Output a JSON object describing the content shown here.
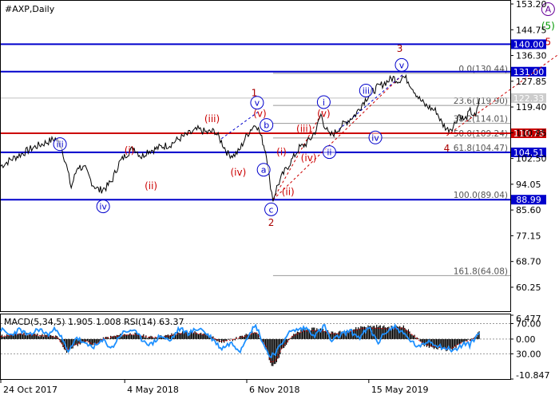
{
  "header": {
    "title": "#AXP,Daily"
  },
  "chart_data": [
    {
      "type": "line",
      "name": "price-panel",
      "ylim": [
        55.0,
        153.2
      ],
      "y_ticks": [
        153.2,
        144.75,
        136.3,
        127.85,
        119.4,
        110.95,
        102.5,
        94.05,
        85.6,
        77.15,
        68.7,
        60.25
      ],
      "x_labels": [
        "24 Oct 2017",
        "4 May 2018",
        "6 Nov 2018",
        "15 May 2019"
      ],
      "x_label_pos": [
        0,
        132,
        262,
        392
      ],
      "x_range": [
        0,
        540
      ],
      "price_path": [
        [
          0,
          100
        ],
        [
          10,
          102
        ],
        [
          22,
          104
        ],
        [
          34,
          106
        ],
        [
          46,
          107.5
        ],
        [
          58,
          109
        ],
        [
          64,
          107
        ],
        [
          70,
          100
        ],
        [
          75,
          93
        ],
        [
          82,
          100
        ],
        [
          90,
          99
        ],
        [
          98,
          94
        ],
        [
          105,
          92
        ],
        [
          112,
          93
        ],
        [
          118,
          95
        ],
        [
          126,
          101
        ],
        [
          134,
          104
        ],
        [
          142,
          106
        ],
        [
          150,
          103
        ],
        [
          156,
          105
        ],
        [
          164,
          105.5
        ],
        [
          172,
          106.5
        ],
        [
          180,
          107
        ],
        [
          190,
          109
        ],
        [
          200,
          110.5
        ],
        [
          210,
          112
        ],
        [
          220,
          111
        ],
        [
          228,
          111.5
        ],
        [
          235,
          108
        ],
        [
          242,
          104
        ],
        [
          248,
          103.5
        ],
        [
          254,
          105
        ],
        [
          260,
          109
        ],
        [
          266,
          112
        ],
        [
          272,
          114
        ],
        [
          277,
          110
        ],
        [
          280,
          107
        ],
        [
          283,
          104
        ],
        [
          286,
          96
        ],
        [
          290,
          89
        ],
        [
          294,
          93
        ],
        [
          300,
          97
        ],
        [
          306,
          100
        ],
        [
          312,
          103
        ],
        [
          318,
          106
        ],
        [
          324,
          107
        ],
        [
          330,
          109
        ],
        [
          336,
          112
        ],
        [
          341,
          117
        ],
        [
          344,
          114
        ],
        [
          350,
          110
        ],
        [
          356,
          111
        ],
        [
          362,
          113
        ],
        [
          370,
          115
        ],
        [
          378,
          117
        ],
        [
          386,
          121
        ],
        [
          394,
          124
        ],
        [
          402,
          126
        ],
        [
          410,
          127.5
        ],
        [
          418,
          129
        ],
        [
          424,
          128
        ],
        [
          428,
          129.5
        ],
        [
          434,
          128
        ],
        [
          440,
          125
        ],
        [
          446,
          122
        ],
        [
          452,
          120
        ],
        [
          458,
          119
        ],
        [
          464,
          118
        ],
        [
          470,
          114
        ],
        [
          476,
          112
        ],
        [
          482,
          113
        ],
        [
          488,
          117
        ],
        [
          494,
          115
        ],
        [
          500,
          118
        ],
        [
          506,
          116
        ],
        [
          510,
          122.3
        ]
      ],
      "levels": [
        {
          "value": 140.0,
          "label": "140.00",
          "color": "#0000cc"
        },
        {
          "value": 131.0,
          "label": "131.00",
          "color": "#0000cc"
        },
        {
          "value": 110.78,
          "label": "110.78",
          "color": "#cc0000"
        },
        {
          "value": 104.51,
          "label": "104.51",
          "color": "#0000cc"
        },
        {
          "value": 88.99,
          "label": "88.99",
          "color": "#0000cc"
        }
      ],
      "current_price": {
        "value": 122.33,
        "label": "122.33"
      },
      "fib_levels": [
        {
          "value": 130.44,
          "label": "0.0(130.44)"
        },
        {
          "value": 119.9,
          "label": "23.6(119.90)"
        },
        {
          "value": 114.01,
          "label": "38.2(114.01)"
        },
        {
          "value": 109.24,
          "label": "50.0(109.24)"
        },
        {
          "value": 104.47,
          "label": "61.8(104.47)"
        },
        {
          "value": 89.04,
          "label": "100.0(89.04)"
        },
        {
          "value": 64.08,
          "label": "161.8(64.08)"
        }
      ],
      "fib_x_start": 290,
      "wave_labels": [
        {
          "text": "A",
          "x": 583,
          "y": 151.5,
          "color": "#660099",
          "circle": true
        },
        {
          "text": "(5)",
          "x": 583,
          "y": 146.0,
          "color": "#009900",
          "circle": false
        },
        {
          "text": "5",
          "x": 583,
          "y": 140.8,
          "color": "#cc0000",
          "circle": false
        },
        {
          "text": "3",
          "x": 425,
          "y": 138.5,
          "color": "#aa0000",
          "circle": false
        },
        {
          "text": "v",
          "x": 427,
          "y": 133.2,
          "color": "#0000cc",
          "circle": true
        },
        {
          "text": "iii",
          "x": 389,
          "y": 124.8,
          "color": "#0000cc",
          "circle": true
        },
        {
          "text": "i",
          "x": 344,
          "y": 121.0,
          "color": "#0000cc",
          "circle": true
        },
        {
          "text": "(v)",
          "x": 344,
          "y": 117.2,
          "color": "#cc0000",
          "circle": false
        },
        {
          "text": "(iii)",
          "x": 323,
          "y": 112.2,
          "color": "#cc0000",
          "circle": false
        },
        {
          "text": "iv",
          "x": 399,
          "y": 109.4,
          "color": "#0000cc",
          "circle": true
        },
        {
          "text": "4",
          "x": 475,
          "y": 105.8,
          "color": "#aa0000",
          "circle": false
        },
        {
          "text": "(iv)",
          "x": 328,
          "y": 102.6,
          "color": "#cc0000",
          "circle": false
        },
        {
          "text": "ii",
          "x": 350,
          "y": 104.6,
          "color": "#0000cc",
          "circle": true
        },
        {
          "text": "(ii)",
          "x": 306,
          "y": 91.5,
          "color": "#cc0000",
          "circle": false
        },
        {
          "text": "(i)",
          "x": 299,
          "y": 104.6,
          "color": "#cc0000",
          "circle": false
        },
        {
          "text": "1",
          "x": 270,
          "y": 124.0,
          "color": "#aa0000",
          "circle": false
        },
        {
          "text": "v",
          "x": 273,
          "y": 120.8,
          "color": "#0000cc",
          "circle": true
        },
        {
          "text": "(v)",
          "x": 276,
          "y": 117.2,
          "color": "#cc0000",
          "circle": false
        },
        {
          "text": "b",
          "x": 283,
          "y": 113.5,
          "color": "#0000cc",
          "circle": true
        },
        {
          "text": "(iii)",
          "x": 225,
          "y": 115.5,
          "color": "#cc0000",
          "circle": false
        },
        {
          "text": "a",
          "x": 280,
          "y": 98.8,
          "color": "#0000cc",
          "circle": true
        },
        {
          "text": "(iv)",
          "x": 253,
          "y": 98.0,
          "color": "#cc0000",
          "circle": false
        },
        {
          "text": "c",
          "x": 288,
          "y": 85.8,
          "color": "#0000cc",
          "circle": true
        },
        {
          "text": "2",
          "x": 288,
          "y": 81.4,
          "color": "#aa0000",
          "circle": false
        },
        {
          "text": "iii",
          "x": 63,
          "y": 107.2,
          "color": "#0000cc",
          "circle": true
        },
        {
          "text": "(i)",
          "x": 137,
          "y": 105.2,
          "color": "#cc0000",
          "circle": false
        },
        {
          "text": "(ii)",
          "x": 160,
          "y": 93.5,
          "color": "#cc0000",
          "circle": false
        },
        {
          "text": "iv",
          "x": 109,
          "y": 86.8,
          "color": "#0000cc",
          "circle": true
        }
      ],
      "projection_lines": [
        {
          "from": [
            290,
            89
          ],
          "to": [
            343,
            118
          ],
          "color": "#cc0000"
        },
        {
          "from": [
            290,
            89
          ],
          "to": [
            428,
            130
          ],
          "color": "#cc0000"
        },
        {
          "from": [
            475,
            110
          ],
          "to": [
            600,
            138
          ],
          "color": "#cc0000"
        },
        {
          "from": [
            235,
            109
          ],
          "to": [
            275,
            118
          ],
          "color": "#0000cc"
        },
        {
          "from": [
            360,
            112
          ],
          "to": [
            428,
            130
          ],
          "color": "#0000cc"
        }
      ]
    },
    {
      "type": "line",
      "name": "indicator-panel",
      "label": "MACD(5,34,5) 1.905 1.008 RSI(14) 63.37",
      "ylim": [
        -10.847,
        6.477
      ],
      "y_ticks": [
        {
          "value": 6.477,
          "label": "6.477"
        },
        {
          "value": 4.2,
          "label": "70.00"
        },
        {
          "value": 0.0,
          "label": "0.00"
        },
        {
          "value": -4.0,
          "label": "30.00"
        },
        {
          "value": -10.847,
          "label": "-10.847"
        }
      ],
      "dashed_levels": [
        4.2,
        0.0,
        -4.0
      ],
      "macd_hist": [
        [
          0,
          0.8
        ],
        [
          20,
          1.6
        ],
        [
          40,
          1.2
        ],
        [
          60,
          0.6
        ],
        [
          70,
          -3.5
        ],
        [
          78,
          -2.0
        ],
        [
          90,
          -0.5
        ],
        [
          100,
          -1.8
        ],
        [
          110,
          0.2
        ],
        [
          125,
          1.0
        ],
        [
          140,
          1.5
        ],
        [
          160,
          0.5
        ],
        [
          175,
          0.8
        ],
        [
          190,
          1.7
        ],
        [
          205,
          2.0
        ],
        [
          220,
          1.2
        ],
        [
          235,
          -0.8
        ],
        [
          245,
          -0.3
        ],
        [
          260,
          0.9
        ],
        [
          272,
          2.2
        ],
        [
          282,
          -2.0
        ],
        [
          288,
          -7.5
        ],
        [
          293,
          -6.8
        ],
        [
          300,
          -2.5
        ],
        [
          310,
          0.8
        ],
        [
          322,
          2.5
        ],
        [
          340,
          2.8
        ],
        [
          355,
          1.6
        ],
        [
          370,
          2.2
        ],
        [
          385,
          3.4
        ],
        [
          400,
          3.5
        ],
        [
          415,
          3.2
        ],
        [
          428,
          3.6
        ],
        [
          440,
          1.0
        ],
        [
          450,
          -1.5
        ],
        [
          460,
          -2.3
        ],
        [
          470,
          -2.8
        ],
        [
          480,
          -3.0
        ],
        [
          488,
          -1.5
        ],
        [
          495,
          -0.8
        ],
        [
          502,
          -0.2
        ],
        [
          510,
          1.9
        ]
      ],
      "rsi": [
        [
          0,
          2.6
        ],
        [
          10,
          1.0
        ],
        [
          20,
          2.6
        ],
        [
          30,
          0.8
        ],
        [
          40,
          2.8
        ],
        [
          50,
          1.2
        ],
        [
          60,
          3.0
        ],
        [
          66,
          -0.5
        ],
        [
          72,
          -3.8
        ],
        [
          80,
          0.6
        ],
        [
          90,
          -1.6
        ],
        [
          100,
          -2.0
        ],
        [
          110,
          -0.4
        ],
        [
          118,
          -2.6
        ],
        [
          128,
          1.4
        ],
        [
          140,
          2.6
        ],
        [
          150,
          0.0
        ],
        [
          160,
          -1.6
        ],
        [
          170,
          1.0
        ],
        [
          180,
          -0.6
        ],
        [
          190,
          2.8
        ],
        [
          200,
          1.6
        ],
        [
          212,
          3.0
        ],
        [
          225,
          0.2
        ],
        [
          235,
          -2.6
        ],
        [
          245,
          -1.0
        ],
        [
          255,
          -3.0
        ],
        [
          265,
          2.0
        ],
        [
          272,
          3.6
        ],
        [
          280,
          -1.4
        ],
        [
          286,
          -4.6
        ],
        [
          292,
          -3.8
        ],
        [
          298,
          -2.0
        ],
        [
          305,
          1.5
        ],
        [
          315,
          2.5
        ],
        [
          325,
          3.0
        ],
        [
          335,
          1.0
        ],
        [
          345,
          3.6
        ],
        [
          352,
          -0.8
        ],
        [
          362,
          1.2
        ],
        [
          372,
          2.2
        ],
        [
          382,
          0.4
        ],
        [
          392,
          3.0
        ],
        [
          402,
          -1.0
        ],
        [
          410,
          2.0
        ],
        [
          420,
          3.4
        ],
        [
          430,
          1.2
        ],
        [
          438,
          -0.8
        ],
        [
          446,
          -2.4
        ],
        [
          455,
          -0.4
        ],
        [
          465,
          -1.6
        ],
        [
          475,
          -2.6
        ],
        [
          485,
          -3.0
        ],
        [
          493,
          -1.2
        ],
        [
          500,
          -1.6
        ],
        [
          505,
          0.4
        ],
        [
          510,
          1.6
        ]
      ]
    }
  ],
  "colors": {
    "price_line": "#000000",
    "level_blue": "#0000cc",
    "level_red": "#cc0000",
    "axis_label_blue_bg": "#0000cc",
    "axis_label_red_bg": "#cc0000",
    "current_price_bg": "#cccccc",
    "fib_text": "#555555",
    "fib_line": "#999999",
    "macd_hist": "#000000",
    "macd_signal": "#cc0000",
    "rsi_line": "#1e90ff",
    "grid": "#999999"
  }
}
